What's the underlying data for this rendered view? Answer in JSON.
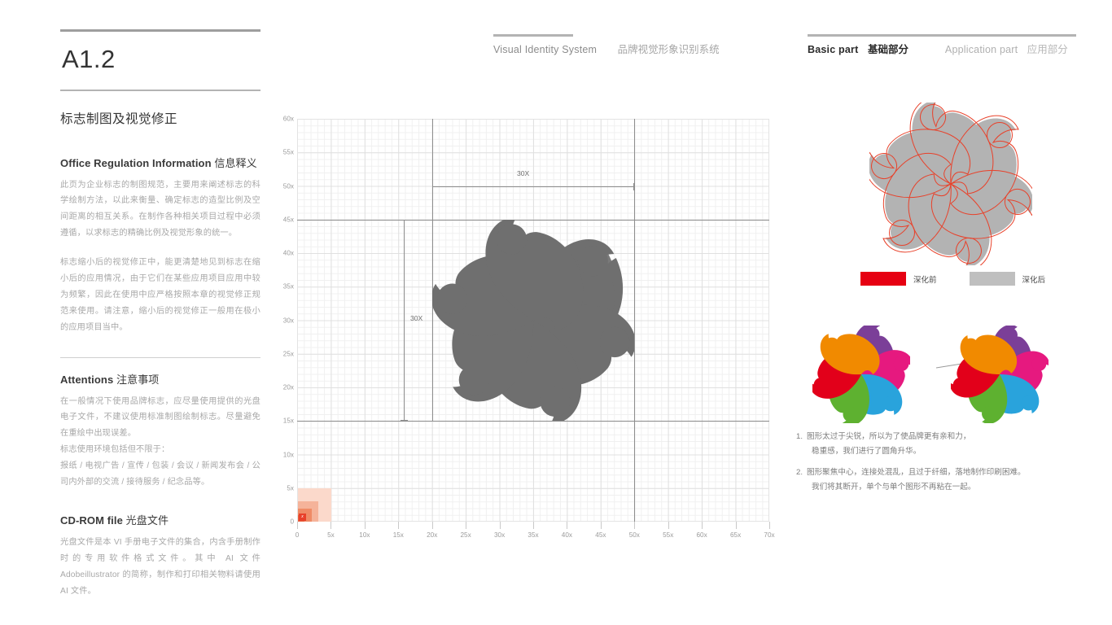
{
  "header": {
    "left_group": {
      "en": "Visual Identity System",
      "cn": "品牌视觉形象识别系统"
    },
    "right_group": {
      "active_en": "Basic part",
      "active_cn": "基础部分",
      "dim_en": "Application part",
      "dim_cn": "应用部分"
    }
  },
  "left": {
    "code": "A1.2",
    "section_title": "标志制图及视觉修正",
    "blocks": [
      {
        "heading_en": "Office Regulation Information",
        "heading_cn": "信息释义",
        "paragraphs": [
          "此页为企业标志的制图规范，主要用来阐述标志的科学绘制方法，以此来衡量、确定标志的造型比例及空间距离的相互关系。在制作各种相关项目过程中必须遵循，以求标志的精确比例及视觉形象的统一。",
          "标志缩小后的视觉修正中，能更清楚地见到标志在缩小后的应用情况，由于它们在某些应用项目应用中较为频繁，因此在使用中应严格按照本章的视觉修正规范来使用。请注意，缩小后的视觉修正一般用在极小的应用项目当中。"
        ]
      },
      {
        "heading_en": "Attentions",
        "heading_cn": "注意事项",
        "paragraphs": [
          "在一般情况下使用品牌标志，应尽量使用提供的光盘电子文件，不建议使用标准制图绘制标志。尽量避免在重绘中出现误差。",
          "标志使用环境包括但不限于：",
          "报纸 / 电视广告 / 宣传 / 包装 / 会议 / 新闻发布会 / 公司内外部的交流 / 接待服务 / 纪念品等。"
        ]
      },
      {
        "heading_en": "CD-ROM file",
        "heading_cn": "光盘文件",
        "paragraphs": [
          "光盘文件是本 VI 手册电子文件的集合，内含手册制作时的专用软件格式文件。其中 AI 文件 Adobeillustrator 的简称，制作和打印相关物料请使用 AI 文件。"
        ]
      }
    ]
  },
  "chart_data": {
    "type": "scatter",
    "title": "",
    "xlabel": "",
    "ylabel": "",
    "xlim": [
      0,
      70
    ],
    "ylim": [
      0,
      60
    ],
    "xticks": [
      "0",
      "5x",
      "10x",
      "15x",
      "20x",
      "25x",
      "30x",
      "35x",
      "40x",
      "45x",
      "50x",
      "55x",
      "60x",
      "65x",
      "70x"
    ],
    "yticks": [
      "0",
      "5x",
      "10x",
      "15x",
      "20x",
      "25x",
      "30x",
      "35x",
      "40x",
      "45x",
      "50x",
      "55x",
      "60x"
    ],
    "grid": "minor 1x, major 5x",
    "annotations": [
      {
        "label": "30X",
        "axis": "horizontal",
        "from": 20,
        "to": 50,
        "at": 50
      },
      {
        "label": "30X",
        "axis": "vertical",
        "from": 15,
        "to": 45,
        "at": 20
      }
    ],
    "guides": [
      {
        "orientation": "vertical",
        "value": 20
      },
      {
        "orientation": "vertical",
        "value": 50
      },
      {
        "orientation": "horizontal",
        "value": 15
      },
      {
        "orientation": "horizontal",
        "value": 45
      }
    ],
    "origin_marker": {
      "label": "x",
      "color": "#e8412a",
      "steps": [
        1,
        2,
        3,
        5
      ]
    },
    "logo_bbox": {
      "x": [
        20,
        50
      ],
      "y": [
        15,
        45
      ]
    }
  },
  "right": {
    "legend": [
      {
        "label": "深化前",
        "color": "#e60012"
      },
      {
        "label": "深化后",
        "color": "#bfbfbf"
      }
    ],
    "logo_colors": [
      "#f18a00",
      "#7b3f98",
      "#e6197f",
      "#29a3dc",
      "#5eb130",
      "#e2001a"
    ],
    "outline_color": "#e8412a",
    "gray_color": "#b3b3b3",
    "notes": [
      {
        "num": "1.",
        "lines": [
          "图形太过于尖锐，所以为了使品牌更有亲和力，",
          "稳重感，我们进行了圆角升华。"
        ]
      },
      {
        "num": "2.",
        "lines": [
          "图形聚焦中心，连接处混乱，且过于纤细，落地制作印刷困难。",
          "我们将其断开，单个与单个图形不再粘在一起。"
        ]
      }
    ]
  }
}
